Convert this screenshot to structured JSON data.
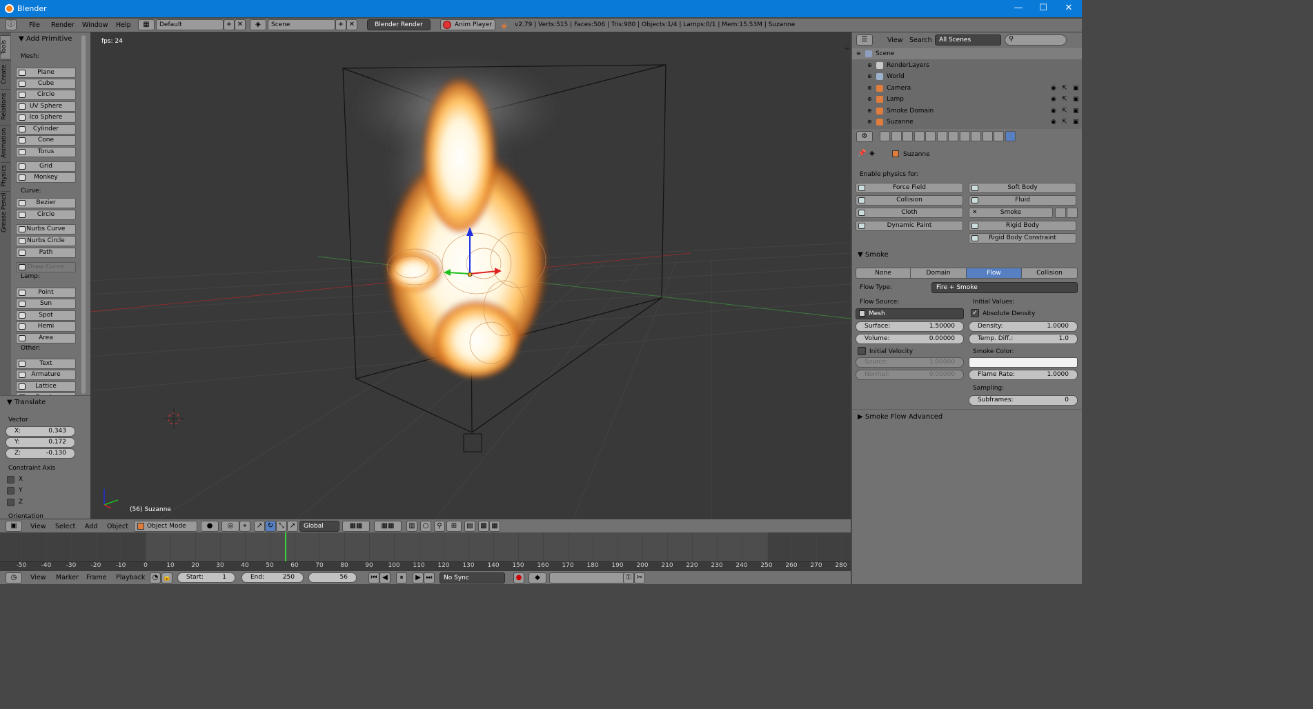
{
  "window": {
    "title": "Blender",
    "minimize": "—",
    "maximize": "☐",
    "close": "✕"
  },
  "info_bar": {
    "menus": [
      "File",
      "Render",
      "Window",
      "Help"
    ],
    "screen_layout": "Default",
    "scene": "Scene",
    "render_engine": "Blender Render",
    "anim_player": "Anim Player",
    "stats": "v2.79 | Verts:515 | Faces:506 | Tris:980 | Objects:1/4 | Lamps:0/1 | Mem:15.53M | Suzanne"
  },
  "tool_shelf": {
    "tabs": [
      "Tools",
      "Create",
      "Relations",
      "Animation",
      "Physics",
      "Grease Pencil"
    ],
    "panel_title": "Add Primitive",
    "groups": [
      {
        "label": "Mesh:",
        "items": [
          "Plane",
          "Cube",
          "Circle",
          "UV Sphere",
          "Ico Sphere",
          "Cylinder",
          "Cone",
          "Torus"
        ]
      },
      {
        "label": "",
        "items": [
          "Grid",
          "Monkey"
        ]
      },
      {
        "label": "Curve:",
        "items": [
          "Bezier",
          "Circle"
        ]
      },
      {
        "label": "",
        "items": [
          "Nurbs Curve",
          "Nurbs Circle",
          "Path"
        ]
      },
      {
        "label": "",
        "items": [
          "Draw Curve"
        ]
      },
      {
        "label": "Lamp:",
        "items": [
          "Point",
          "Sun",
          "Spot",
          "Hemi",
          "Area"
        ]
      },
      {
        "label": "Other:",
        "items": [
          "Text",
          "Armature",
          "Lattice",
          "Empty"
        ]
      }
    ],
    "operator": {
      "title": "Translate",
      "vector_label": "Vector",
      "x_label": "X:",
      "x": "0.343",
      "y_label": "Y:",
      "y": "0.172",
      "z_label": "Z:",
      "z": "-0.130",
      "constraint_label": "Constraint Axis",
      "axes": [
        "X",
        "Y",
        "Z"
      ],
      "orientation_label": "Orientation"
    }
  },
  "viewport": {
    "fps": "fps: 24",
    "object_info": "(56) Suzanne",
    "header": {
      "menus": [
        "View",
        "Select",
        "Add",
        "Object"
      ],
      "mode": "Object Mode",
      "orientation": "Global"
    }
  },
  "timeline": {
    "ticks": [
      "-50",
      "-40",
      "-30",
      "-20",
      "-10",
      "0",
      "10",
      "20",
      "30",
      "40",
      "50",
      "60",
      "70",
      "80",
      "90",
      "100",
      "110",
      "120",
      "130",
      "140",
      "150",
      "160",
      "170",
      "180",
      "190",
      "200",
      "210",
      "220",
      "230",
      "240",
      "250",
      "260",
      "270",
      "280"
    ],
    "current_frame_value": 56,
    "range_start": 0,
    "range_end": 250,
    "header": {
      "menus": [
        "View",
        "Marker",
        "Frame",
        "Playback"
      ],
      "start_label": "Start:",
      "start": "1",
      "end_label": "End:",
      "end": "250",
      "current": "56",
      "sync": "No Sync"
    }
  },
  "outliner": {
    "menus": [
      "View",
      "Search"
    ],
    "display_mode": "All Scenes",
    "items": [
      {
        "label": "Scene",
        "color": "#8e9fc0"
      },
      {
        "label": "RenderLayers",
        "color": "#c9c9c9"
      },
      {
        "label": "World",
        "color": "#9cb2cb"
      },
      {
        "label": "Camera",
        "color": "#e07d3c"
      },
      {
        "label": "Lamp",
        "color": "#e07d3c"
      },
      {
        "label": "Smoke Domain",
        "color": "#e07d3c"
      },
      {
        "label": "Suzanne",
        "color": "#e07d3c"
      }
    ]
  },
  "properties": {
    "context_object": "Suzanne",
    "enable_label": "Enable physics for:",
    "physics_buttons": [
      "Force Field",
      "Soft Body",
      "Collision",
      "Fluid",
      "Cloth",
      "Smoke",
      "Dynamic Paint",
      "Rigid Body",
      "",
      "Rigid Body Constraint"
    ],
    "smoke_panel": "Smoke",
    "smoke_types": [
      "None",
      "Domain",
      "Flow",
      "Collision"
    ],
    "active_smoke_type": "Flow",
    "flow_type_label": "Flow Type:",
    "flow_type": "Fire + Smoke",
    "flow_source_label": "Flow Source:",
    "flow_source": "Mesh",
    "initial_values_label": "Initial Values:",
    "absolute_density": "Absolute Density",
    "surface_label": "Surface:",
    "surface": "1.50000",
    "volume_label": "Volume:",
    "volume": "0.00000",
    "density_label": "Density:",
    "density": "1.0000",
    "temp_label": "Temp. Diff.:",
    "temp": "1.0",
    "initial_velocity": "Initial Velocity",
    "source_label": "Source:",
    "source": "1.00000",
    "normal_label": "Normal:",
    "normal": "0.00000",
    "smoke_color_label": "Smoke Color:",
    "flame_rate_label": "Flame Rate:",
    "flame_rate": "1.0000",
    "sampling_label": "Sampling:",
    "subframes_label": "Subframes:",
    "subframes": "0",
    "advanced_panel": "Smoke Flow Advanced",
    "colors": {
      "accent": "#5680c2",
      "panel": "#727272"
    }
  }
}
